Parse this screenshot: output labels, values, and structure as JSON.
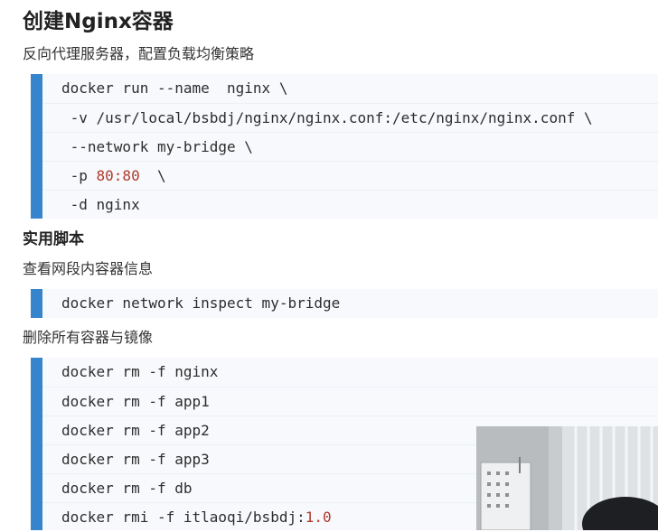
{
  "heading": "创建Nginx容器",
  "intro": "反向代理服务器，配置负载均衡策略",
  "nginx_code": {
    "lines": [
      {
        "text": "docker run --name  nginx \\"
      },
      {
        "text": " -v /usr/local/bsbdj/nginx/nginx.conf:/etc/nginx/nginx.conf \\"
      },
      {
        "text": " --network my-bridge \\"
      },
      {
        "pre": " -p ",
        "num": "80:80",
        "post": "  \\"
      },
      {
        "text": " -d nginx"
      }
    ]
  },
  "scripts_heading": "实用脚本",
  "inspect_caption": "查看网段内容器信息",
  "inspect_code": "docker network inspect my-bridge",
  "remove_caption": "删除所有容器与镜像",
  "remove_code": {
    "lines": [
      {
        "text": "docker rm -f nginx"
      },
      {
        "text": "docker rm -f app1"
      },
      {
        "text": "docker rm -f app2"
      },
      {
        "text": "docker rm -f app3"
      },
      {
        "text": "docker rm -f db"
      },
      {
        "pre": "docker rmi -f itlaoqi/bsbdj:",
        "num": "1.0",
        "post": ""
      }
    ]
  },
  "colors": {
    "accent_bar": "#3685cc",
    "code_bg": "#f7f9fc",
    "number": "#b03a2e"
  }
}
